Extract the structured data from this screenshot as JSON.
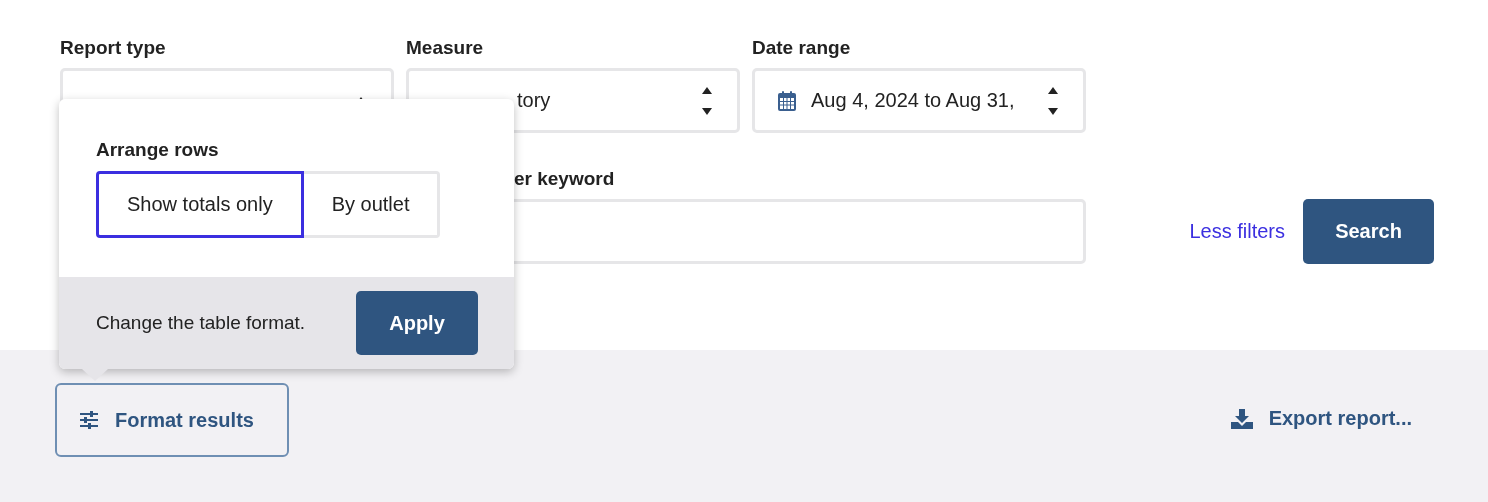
{
  "filters": [
    {
      "kind": "select",
      "label": "Report type"
    },
    {
      "kind": "select",
      "label": "Measure",
      "value": "tory"
    },
    {
      "kind": "date",
      "label": "Date range",
      "value": "Aug 4, 2024 to Aug 31,"
    }
  ],
  "keyword": {
    "label": "er keyword"
  },
  "less_filters_link": "Less filters",
  "search_button": "Search",
  "popover": {
    "title": "Arrange rows",
    "options": [
      {
        "label": "Show totals only",
        "selected": true
      },
      {
        "label": "By outlet",
        "selected": false
      }
    ],
    "footer_text": "Change the table format.",
    "apply_button": "Apply"
  },
  "format_results_button": "Format results",
  "export_report_link": "Export report..."
}
